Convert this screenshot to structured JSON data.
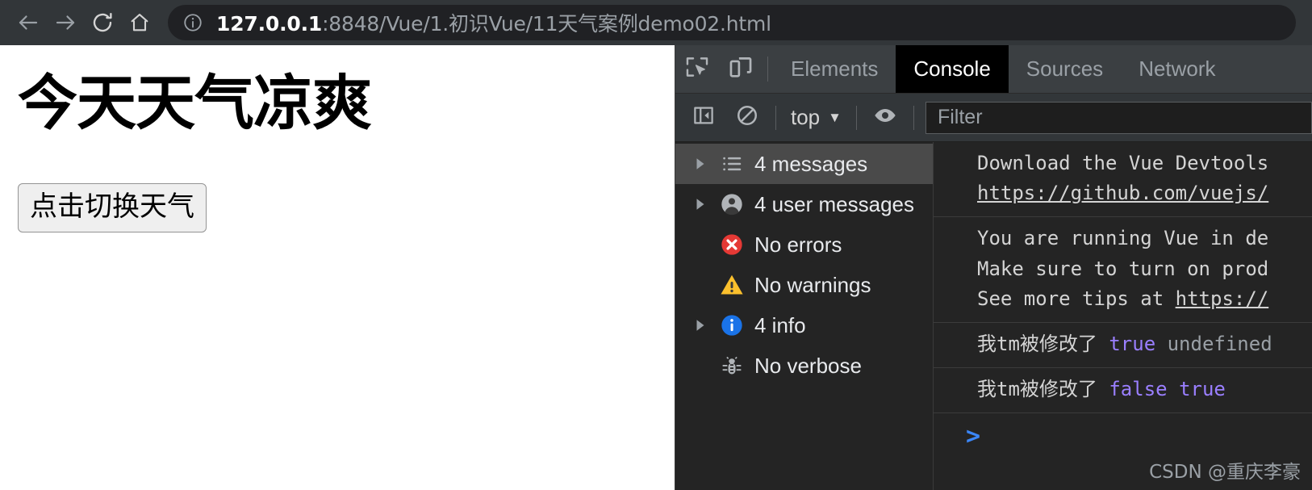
{
  "browser": {
    "back_label": "back-arrow",
    "forward_label": "forward-arrow",
    "reload_label": "reload",
    "home_label": "home",
    "url_host": "127.0.0.1",
    "url_rest": ":8848/Vue/1.初识Vue/11天气案例demo02.html",
    "url_full": "127.0.0.1:8848/Vue/1.初识Vue/11天气案例demo02.html"
  },
  "page": {
    "heading": "今天天气凉爽",
    "button_label": "点击切换天气"
  },
  "devtools": {
    "tabs": [
      {
        "label": "Elements",
        "active": false
      },
      {
        "label": "Console",
        "active": true
      },
      {
        "label": "Sources",
        "active": false
      },
      {
        "label": "Network",
        "active": false
      }
    ],
    "toolbar": {
      "context_label": "top",
      "filter_placeholder": "Filter"
    },
    "sidebar": [
      {
        "label": "4 messages",
        "icon": "list-icon",
        "expandable": true,
        "selected": true
      },
      {
        "label": "4 user messages",
        "icon": "user-icon",
        "expandable": true,
        "selected": false
      },
      {
        "label": "No errors",
        "icon": "error-icon",
        "expandable": false,
        "selected": false
      },
      {
        "label": "No warnings",
        "icon": "warning-icon",
        "expandable": false,
        "selected": false
      },
      {
        "label": "4 info",
        "icon": "info-icon",
        "expandable": true,
        "selected": false
      },
      {
        "label": "No verbose",
        "icon": "bug-icon",
        "expandable": false,
        "selected": false
      }
    ],
    "messages": [
      {
        "line1": "Download the Vue Devtools",
        "line2": "https://github.com/vuejs/"
      },
      {
        "line1": "You are running Vue in de",
        "line2": "Make sure to turn on prod",
        "line3": "See more tips at https://"
      }
    ],
    "logs": [
      {
        "text": "我tm被修改了",
        "arg1": "true",
        "arg2": "undefined"
      },
      {
        "text": "我tm被修改了",
        "arg1": "false",
        "arg2": "true"
      }
    ],
    "prompt": ">"
  },
  "watermark": "CSDN @重庆李豪",
  "colors": {
    "chrome_bg": "#323639",
    "omnibox_bg": "#202124",
    "devtools_bg": "#242424",
    "tabbar_bg": "#3b3f42",
    "active_tab_bg": "#000000",
    "selected_row_bg": "#4a4a4a",
    "error_red": "#e53935",
    "warning_yellow": "#fbc02d",
    "info_blue": "#1a73e8",
    "prompt_blue": "#3b86f7",
    "bool_violet": "#9a7fff"
  }
}
